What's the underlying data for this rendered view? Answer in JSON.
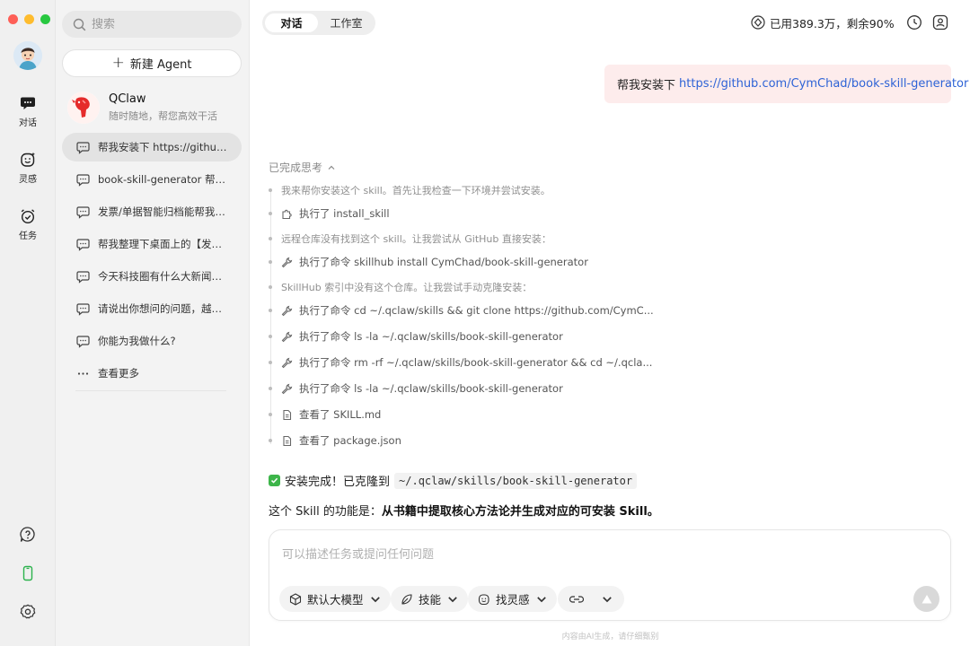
{
  "sidebar": {
    "search_placeholder": "搜索",
    "new_agent_label": "新建 Agent",
    "agent": {
      "name": "QClaw",
      "subtitle": "随时随地，帮您高效干活"
    },
    "chats": [
      {
        "label": "帮我安装下 https://github.com/CymChad/book-skill-generator",
        "active": true
      },
      {
        "label": "book-skill-generator 帮我生成…"
      },
      {
        "label": "发票/单据智能归档能帮我做什么"
      },
      {
        "label": "帮我整理下桌面上的【发票】文件夹"
      },
      {
        "label": "今天科技圈有什么大新闻，帮我总结一下"
      },
      {
        "label": "请说出你想问的问题，越具体越好"
      },
      {
        "label": "你能为我做什么?"
      }
    ],
    "more_label": "查看更多"
  },
  "rail": {
    "nav": [
      {
        "label": "对话",
        "icon": "chat-bubble-icon"
      },
      {
        "label": "灵感",
        "icon": "smile-sparkle-icon"
      },
      {
        "label": "任务",
        "icon": "alarm-clock-icon"
      }
    ],
    "bottom_icons": [
      "help-icon",
      "phone-icon",
      "settings-icon"
    ]
  },
  "header": {
    "tabs": [
      {
        "label": "对话",
        "active": true
      },
      {
        "label": "工作室",
        "active": false
      }
    ],
    "usage_text": "已用389.3万，剩余90%"
  },
  "conversation": {
    "user_message_prefix": "帮我安装下 ",
    "user_message_link": "https://github.com/CymChad/book-skill-generator",
    "thinking_header": "已完成思考",
    "steps": [
      {
        "kind": "note",
        "text": "我来帮你安装这个 skill。首先让我检查一下环境并尝试安装。"
      },
      {
        "kind": "action",
        "icon": "puzzle-icon",
        "text": "执行了 install_skill"
      },
      {
        "kind": "note",
        "text": "远程仓库没有找到这个 skill。让我尝试从 GitHub 直接安装："
      },
      {
        "kind": "action",
        "icon": "wrench-icon",
        "text": "执行了命令 skillhub install CymChad/book-skill-generator"
      },
      {
        "kind": "note",
        "text": "SkillHub 索引中没有这个仓库。让我尝试手动克隆安装："
      },
      {
        "kind": "action",
        "icon": "wrench-icon",
        "text": "执行了命令 cd ~/.qclaw/skills && git clone https://github.com/CymC..."
      },
      {
        "kind": "action",
        "icon": "wrench-icon",
        "text": "执行了命令 ls -la ~/.qclaw/skills/book-skill-generator"
      },
      {
        "kind": "action",
        "icon": "wrench-icon",
        "text": "执行了命令 rm -rf ~/.qclaw/skills/book-skill-generator && cd ~/.qcla..."
      },
      {
        "kind": "action",
        "icon": "wrench-icon",
        "text": "执行了命令 ls -la ~/.qclaw/skills/book-skill-generator"
      },
      {
        "kind": "action",
        "icon": "document-icon",
        "text": "查看了 SKILL.md"
      },
      {
        "kind": "action",
        "icon": "document-icon",
        "text": "查看了 package.json"
      }
    ],
    "done_text": "安装完成！已克隆到",
    "done_path": "~/.qclaw/skills/book-skill-generator",
    "function_prefix": "这个 Skill 的功能是：",
    "function_bold": "从书籍中提取核心方法论并生成对应的可安装 Skill。"
  },
  "composer": {
    "placeholder": "可以描述任务或提问任何问题",
    "chips": [
      {
        "label": "默认大模型",
        "icon": "cube-icon"
      },
      {
        "label": "技能",
        "icon": "leaf-icon"
      },
      {
        "label": "找灵感",
        "icon": "smile-sparkle-icon"
      },
      {
        "label": "",
        "icon": "link-icon"
      }
    ],
    "disclaimer": "内容由AI生成，请仔细甄别"
  },
  "colors": {
    "accent_link": "#2e63d6",
    "user_bubble_bg": "#fdecec",
    "success_green": "#3db54a"
  }
}
